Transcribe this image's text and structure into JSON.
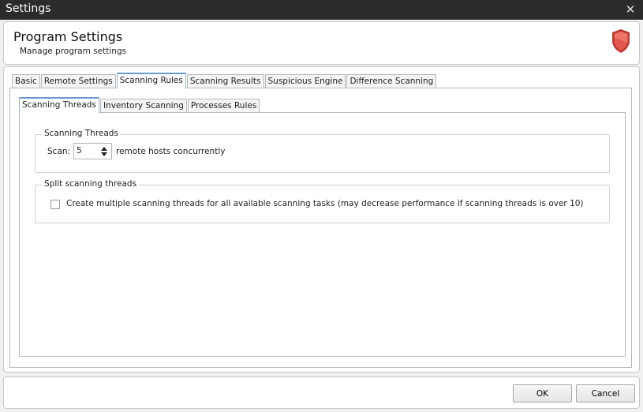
{
  "window": {
    "title": "Settings",
    "close_glyph": "✕"
  },
  "header": {
    "title": "Program Settings",
    "subtitle": "Manage program settings",
    "icon": "shield-icon"
  },
  "outer_tabs": [
    {
      "label": "Basic",
      "active": false
    },
    {
      "label": "Remote Settings",
      "active": false
    },
    {
      "label": "Scanning Rules",
      "active": true
    },
    {
      "label": "Scanning Results",
      "active": false
    },
    {
      "label": "Suspicious Engine",
      "active": false
    },
    {
      "label": "Difference Scanning",
      "active": false
    }
  ],
  "inner_tabs": [
    {
      "label": "Scanning Threads",
      "active": true
    },
    {
      "label": "Inventory Scanning",
      "active": false
    },
    {
      "label": "Processes Rules",
      "active": false
    }
  ],
  "scanning_threads": {
    "group_label": "Scanning Threads",
    "scan_label": "Scan:",
    "value": "5",
    "suffix": "remote hosts concurrently"
  },
  "split_threads": {
    "group_label": "Split scanning threads",
    "checkbox_label": "Create multiple scanning threads for all available scanning tasks (may decrease performance if scanning threads is over 10)",
    "checked": false
  },
  "footer": {
    "ok_label": "OK",
    "cancel_label": "Cancel"
  },
  "colors": {
    "titlebar": "#2b2b2b",
    "shield_red": "#d9473f",
    "tab_accent": "#6a9ad0"
  }
}
